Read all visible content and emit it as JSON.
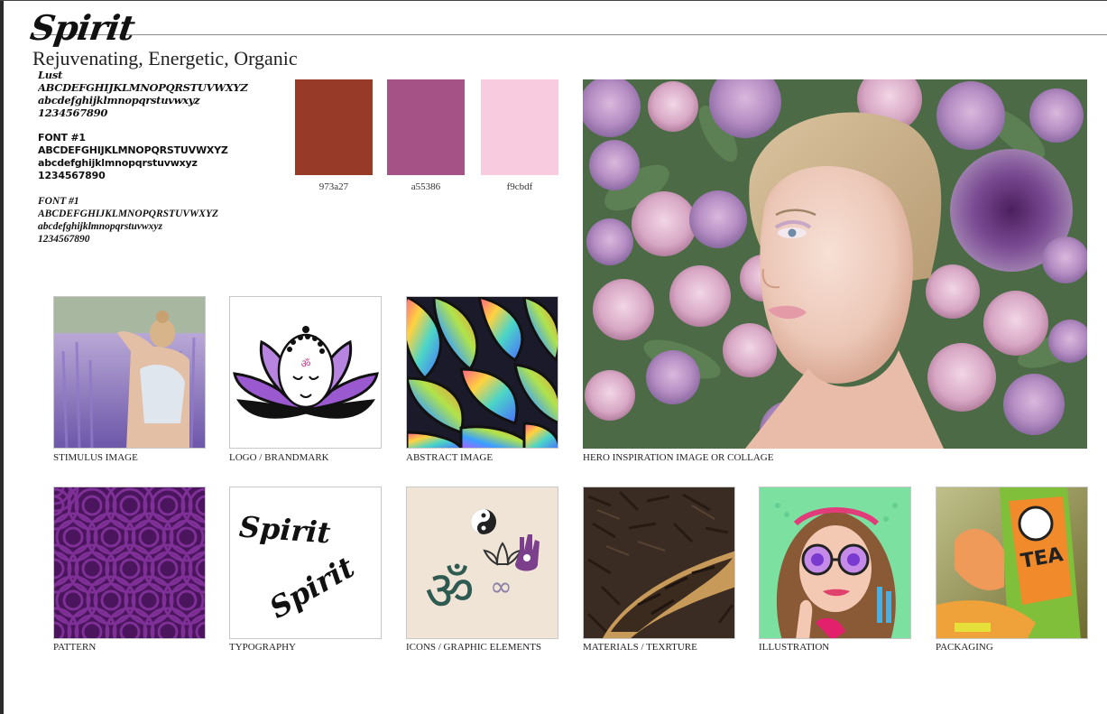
{
  "brand": {
    "title": "Spirit",
    "subtitle": "Rejuvenating, Energetic, Organic"
  },
  "fonts": [
    {
      "name": "Lust",
      "upper": "ABCDEFGHIJKLMNOPQRSTUVWXYZ",
      "lower": "abcdefghijklmnopqrstuvwxyz",
      "digits": "1234567890"
    },
    {
      "name": "FONT #1",
      "upper": "ABCDEFGHIJKLMNOPQRSTUVWXYZ",
      "lower": "abcdefghijklmnopqrstuvwxyz",
      "digits": "1234567890"
    },
    {
      "name": "FONT #1",
      "upper": "ABCDEFGHIJKLMNOPQRSTUVWXYZ",
      "lower": "abcdefghijklmnopqrstuvwxyz",
      "digits": "1234567890"
    }
  ],
  "palette": [
    {
      "hex": "973a27",
      "color": "#973a27"
    },
    {
      "hex": "a55386",
      "color": "#a55386"
    },
    {
      "hex": "f9cbdf",
      "color": "#f9cbdf"
    }
  ],
  "tiles": {
    "stimulus": "STIMULUS IMAGE",
    "logo": "LOGO / BRANDMARK",
    "abstract": "ABSTRACT IMAGE",
    "hero": "HERO INSPIRATION IMAGE OR COLLAGE",
    "pattern": "PATTERN",
    "typography": "TYPOGRAPHY",
    "icons": "ICONS / GRAPHIC ELEMENTS",
    "materials": "MATERIALS / TEXRTURE",
    "illustration": "ILLUSTRATION",
    "packaging": "PACKAGING"
  },
  "typography_sample": "Spirit",
  "packaging_text": "TEA",
  "colors": {
    "rule": "#8a8a8a",
    "lavender": "#8f7ac8",
    "purple_pattern": "#5a1a6e",
    "logo_purple": "#9b59d0"
  }
}
